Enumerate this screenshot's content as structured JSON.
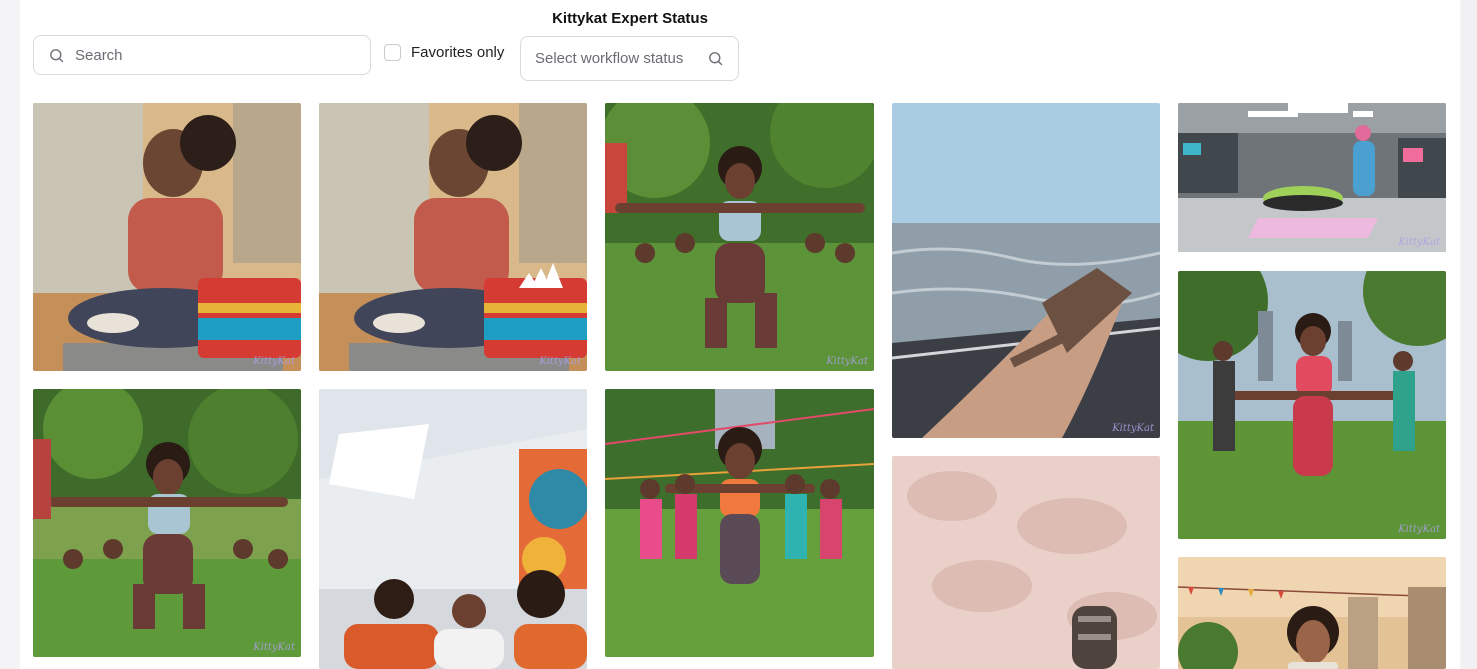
{
  "header": {
    "title": "Kittykat Expert Status"
  },
  "search": {
    "placeholder": "Search",
    "icon": "search-icon"
  },
  "filters": {
    "favorites_label": "Favorites only",
    "favorites_checked": false,
    "status_placeholder": "Select workflow status"
  },
  "gallery": {
    "watermark": "KittyKat",
    "images": [
      {
        "subject": "woman stretching on yoga mat in gym"
      },
      {
        "subject": "woman stretching on yoga mat with adidas towel"
      },
      {
        "subject": "group outdoor fitness class lunges in park"
      },
      {
        "subject": "foot in sandal on boat over sea"
      },
      {
        "subject": "sneaker on display in futuristic lab"
      },
      {
        "subject": "group outdoor fitness class lunges in park"
      },
      {
        "subject": "three friends laughing in bright room"
      },
      {
        "subject": "women running at park festival"
      },
      {
        "subject": "sandal on pink sand"
      },
      {
        "subject": "women lunging in city park"
      },
      {
        "subject": "woman smiling at outdoor festival"
      }
    ]
  }
}
